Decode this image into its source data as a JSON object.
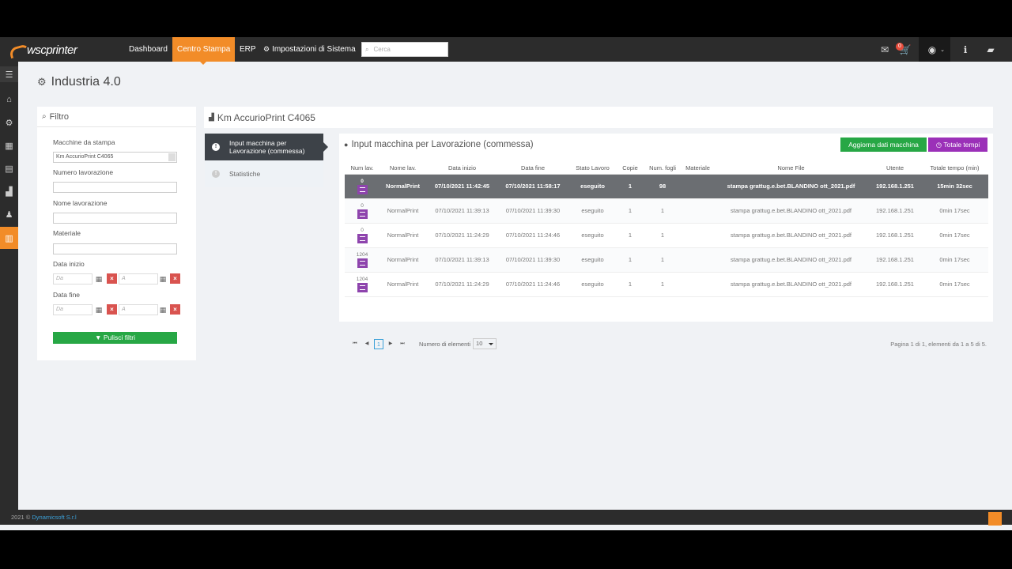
{
  "brand": {
    "logo_text": "wscprinter"
  },
  "nav": {
    "items": [
      "Dashboard",
      "Centro Stampa",
      "ERP",
      "Impostazioni di Sistema"
    ],
    "search_placeholder": "Cerca",
    "cart_badge": "0"
  },
  "page": {
    "title": "Industria 4.0"
  },
  "filter": {
    "title": "Filtro",
    "machine_label": "Macchine da stampa",
    "machine_value": "Km AccurioPrint C4065",
    "job_number_label": "Numero lavorazione",
    "job_name_label": "Nome lavorazione",
    "material_label": "Materiale",
    "start_date_label": "Data inizio",
    "end_date_label": "Data fine",
    "from_placeholder": "Da",
    "to_placeholder": "A",
    "clear_label": "Pulisci filtri"
  },
  "machine_panel": {
    "title": "Km AccurioPrint C4065"
  },
  "tabs": [
    {
      "label": "Input macchina per Lavorazione (commessa)"
    },
    {
      "label": "Statistiche"
    }
  ],
  "content": {
    "title": "Input macchina per Lavorazione (commessa)",
    "refresh_label": "Aggiorna dati macchina",
    "total_label": "Totale tempi"
  },
  "table": {
    "headers": [
      "Num lav.",
      "Nome lav.",
      "Data inizio",
      "Data fine",
      "Stato Lavoro",
      "Copie",
      "Num. fogli",
      "Materiale",
      "Nome File",
      "Utente",
      "Totale tempo (min)"
    ],
    "rows": [
      {
        "num": "0",
        "name": "NormalPrint",
        "start": "07/10/2021 11:42:45",
        "end": "07/10/2021 11:58:17",
        "status": "eseguito",
        "copies": "1",
        "sheets": "98",
        "material": "",
        "file": "stampa grattug.e.bet.BLANDINO ott_2021.pdf",
        "user": "192.168.1.251",
        "total": "15min 32sec"
      },
      {
        "num": "0",
        "name": "NormalPrint",
        "start": "07/10/2021 11:39:13",
        "end": "07/10/2021 11:39:30",
        "status": "eseguito",
        "copies": "1",
        "sheets": "1",
        "material": "",
        "file": "stampa grattug.e.bet.BLANDINO ott_2021.pdf",
        "user": "192.168.1.251",
        "total": "0min 17sec"
      },
      {
        "num": "0",
        "name": "NormalPrint",
        "start": "07/10/2021 11:24:29",
        "end": "07/10/2021 11:24:46",
        "status": "eseguito",
        "copies": "1",
        "sheets": "1",
        "material": "",
        "file": "stampa grattug.e.bet.BLANDINO ott_2021.pdf",
        "user": "192.168.1.251",
        "total": "0min 17sec"
      },
      {
        "num": "1204",
        "name": "NormalPrint",
        "start": "07/10/2021 11:39:13",
        "end": "07/10/2021 11:39:30",
        "status": "eseguito",
        "copies": "1",
        "sheets": "1",
        "material": "",
        "file": "stampa grattug.e.bet.BLANDINO ott_2021.pdf",
        "user": "192.168.1.251",
        "total": "0min 17sec"
      },
      {
        "num": "1204",
        "name": "NormalPrint",
        "start": "07/10/2021 11:24:29",
        "end": "07/10/2021 11:24:46",
        "status": "eseguito",
        "copies": "1",
        "sheets": "1",
        "material": "",
        "file": "stampa grattug.e.bet.BLANDINO ott_2021.pdf",
        "user": "192.168.1.251",
        "total": "0min 17sec"
      }
    ]
  },
  "pager": {
    "current": "1",
    "page_size_label": "Numero di elementi",
    "page_size": "10",
    "info": "Pagina 1 di 1, elementi da 1 a 5 di 5."
  },
  "footer": {
    "year": "2021 ©",
    "company": "Dynamicsoft S.r.l"
  },
  "colors": {
    "accent": "#f28c28",
    "green": "#27a745",
    "purple": "#9b30b8",
    "danger": "#d9534f"
  }
}
